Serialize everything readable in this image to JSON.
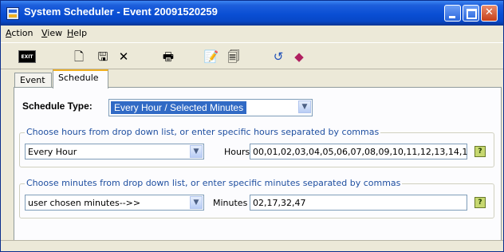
{
  "window": {
    "title": "System Scheduler - Event 20091520259"
  },
  "menu": {
    "items": [
      {
        "underline": "A",
        "rest": "ction"
      },
      {
        "underline": "V",
        "rest": "iew"
      },
      {
        "underline": "H",
        "rest": "elp"
      }
    ]
  },
  "toolbar": {
    "exit_label": "EXIT",
    "buttons": [
      "new-document-icon",
      "save-icon",
      "delete-icon",
      "print-icon",
      "edit-icon",
      "properties-icon",
      "refresh-icon",
      "erase-icon"
    ]
  },
  "tabs": [
    {
      "label": "Event"
    },
    {
      "label": "Schedule",
      "active": true
    }
  ],
  "schedule": {
    "type_label": "Schedule Type:",
    "type_value": "Every Hour / Selected Minutes"
  },
  "hours": {
    "legend": "Choose hours from drop down list, or enter specific hours separated by commas",
    "dropdown_value": "Every Hour",
    "field_label": "Hours",
    "field_value": "00,01,02,03,04,05,06,07,08,09,10,11,12,13,14,1"
  },
  "minutes": {
    "legend": "Choose minutes from drop down list, or enter specific minutes separated by commas",
    "dropdown_value": "user chosen minutes-->>",
    "field_label": "Minutes",
    "field_value": "02,17,32,47"
  },
  "colors": {
    "titlebar": "#0a4fd4",
    "selection": "#316ac5",
    "window_bg": "#ece9d8",
    "panel_bg": "#fcfcfe",
    "legend_text": "#1f4fa0"
  }
}
